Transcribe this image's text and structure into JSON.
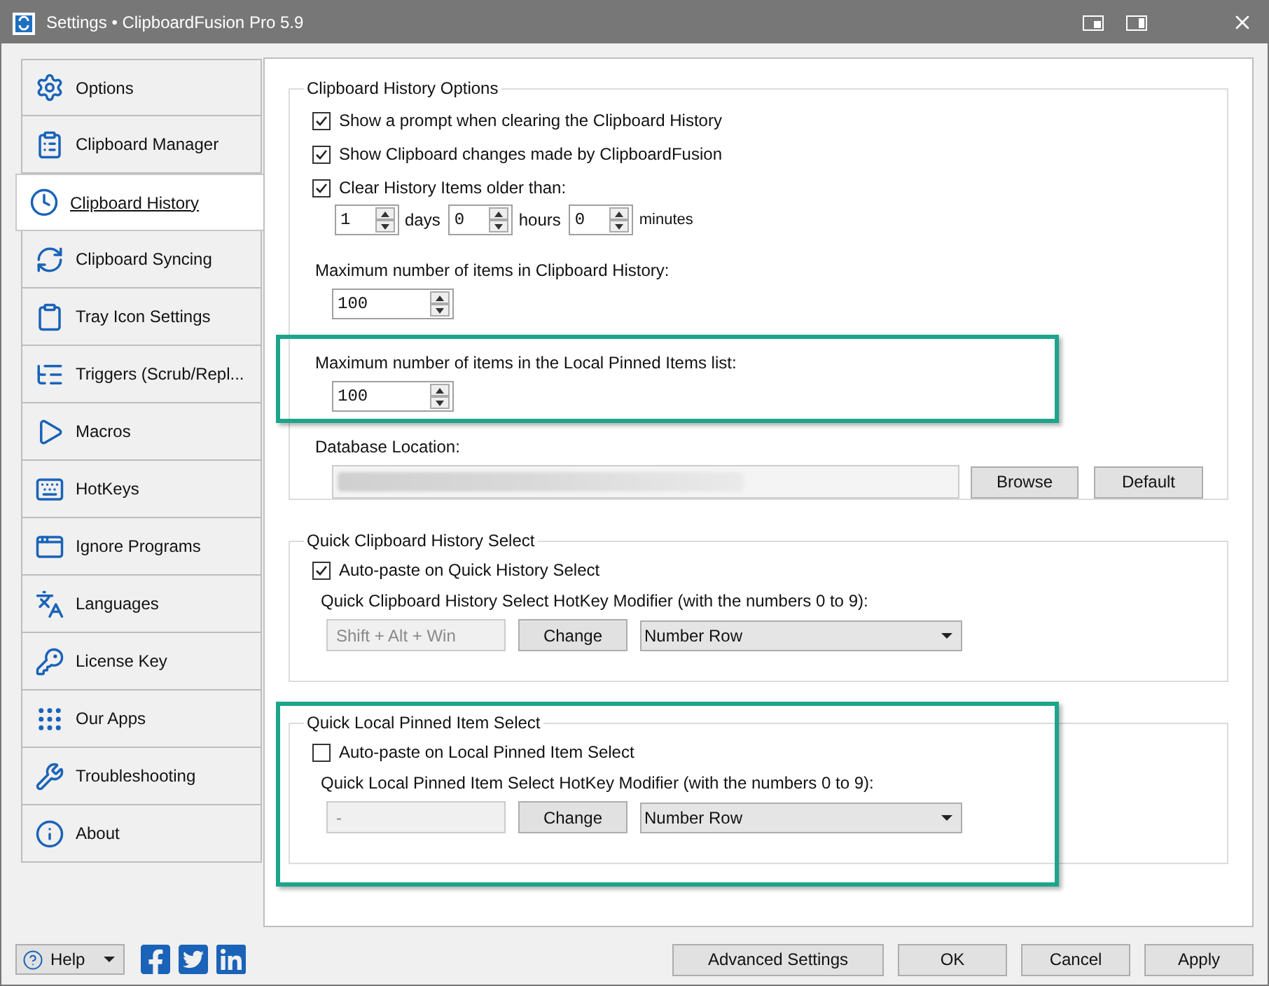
{
  "window": {
    "title": "Settings • ClipboardFusion Pro 5.9"
  },
  "sidebar": {
    "items": [
      {
        "label": "Options",
        "selected": false
      },
      {
        "label": "Clipboard Manager",
        "selected": false
      },
      {
        "label": "Clipboard History",
        "selected": true
      },
      {
        "label": "Clipboard Syncing",
        "selected": false
      },
      {
        "label": "Tray Icon Settings",
        "selected": false
      },
      {
        "label": "Triggers (Scrub/Repl...",
        "selected": false
      },
      {
        "label": "Macros",
        "selected": false
      },
      {
        "label": "HotKeys",
        "selected": false
      },
      {
        "label": "Ignore Programs",
        "selected": false
      },
      {
        "label": "Languages",
        "selected": false
      },
      {
        "label": "License Key",
        "selected": false
      },
      {
        "label": "Our Apps",
        "selected": false
      },
      {
        "label": "Troubleshooting",
        "selected": false
      },
      {
        "label": "About",
        "selected": false
      }
    ]
  },
  "history_options": {
    "title": "Clipboard History Options",
    "checkboxes": [
      {
        "label": "Show a prompt when clearing the Clipboard History",
        "checked": true
      },
      {
        "label": "Show Clipboard changes made by ClipboardFusion",
        "checked": true
      },
      {
        "label": "Clear History Items older than:",
        "checked": true
      }
    ],
    "clear_after": [
      {
        "value": "1",
        "unit": "days"
      },
      {
        "value": "0",
        "unit": "hours"
      },
      {
        "value": "0",
        "unit": "minutes"
      }
    ],
    "max_history": {
      "label": "Maximum number of items in Clipboard History:",
      "value": "100"
    },
    "max_pinned": {
      "label": "Maximum number of items in the Local Pinned Items list:",
      "value": "100"
    },
    "database": {
      "label": "Database Location:"
    },
    "buttons": [
      "Browse",
      "Default"
    ]
  },
  "hotkey_groups": [
    {
      "title": "Quick Clipboard History Select",
      "checkbox": {
        "label": "Auto-paste on Quick History Select",
        "checked": true
      },
      "hotkey_label": "Quick Clipboard History Select HotKey Modifier (with the numbers 0 to 9):",
      "hotkey": "Shift + Alt + Win",
      "change": "Change",
      "dropdown": "Number Row"
    },
    {
      "title": "Quick Local Pinned Item Select",
      "checkbox": {
        "label": "Auto-paste on Local Pinned Item Select",
        "checked": false
      },
      "hotkey_label": "Quick Local Pinned Item Select HotKey Modifier (with the numbers 0 to 9):",
      "hotkey": "-",
      "change": "Change",
      "dropdown": "Number Row"
    }
  ],
  "footer": {
    "help": "Help",
    "buttons": [
      "Advanced Settings",
      "OK",
      "Cancel",
      "Apply"
    ]
  }
}
